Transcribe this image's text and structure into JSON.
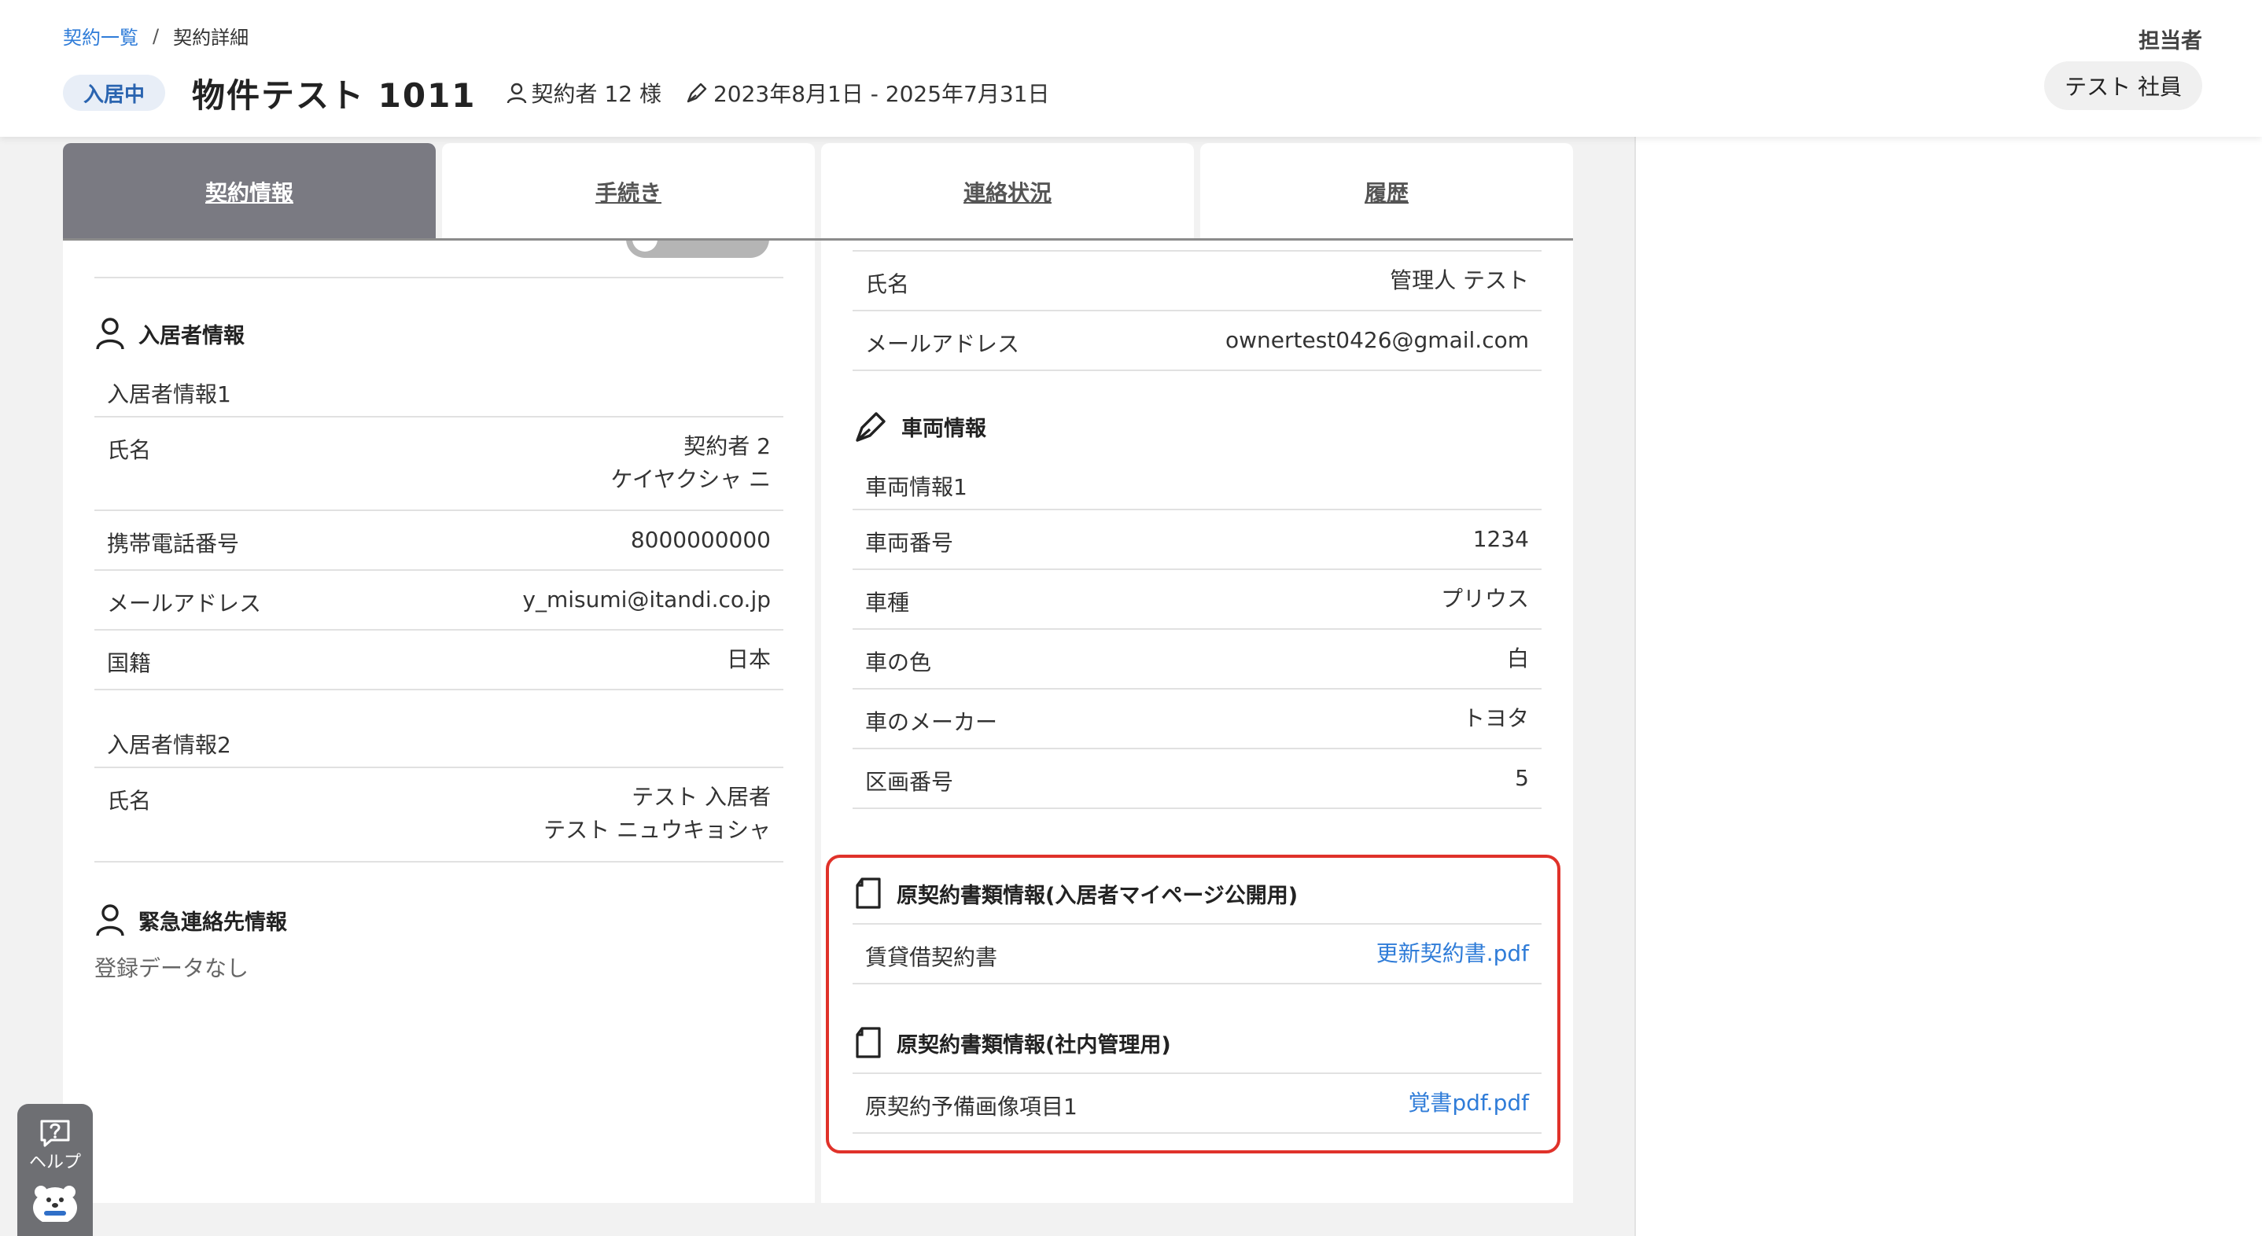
{
  "header": {
    "breadcrumb": {
      "parent": "契約一覧",
      "separator": "/",
      "current": "契約詳細"
    },
    "status_badge": "入居中",
    "title": "物件テスト 1011",
    "contractor": "契約者 12 様",
    "period": "2023年8月1日 - 2025年7月31日",
    "assignee_label": "担当者",
    "assignee_name": "テスト 社員"
  },
  "tabs": [
    {
      "label": "契約情報",
      "active": true
    },
    {
      "label": "手続き",
      "active": false
    },
    {
      "label": "連絡状況",
      "active": false
    },
    {
      "label": "履歴",
      "active": false
    }
  ],
  "residents": {
    "heading": "入居者情報",
    "groups": [
      {
        "title": "入居者情報1",
        "rows": [
          {
            "label": "氏名",
            "value": "契約者 2",
            "value2": "ケイヤクシャ ニ"
          },
          {
            "label": "携帯電話番号",
            "value": "8000000000"
          },
          {
            "label": "メールアドレス",
            "value": "y_misumi@itandi.co.jp"
          },
          {
            "label": "国籍",
            "value": "日本"
          }
        ]
      },
      {
        "title": "入居者情報2",
        "rows": [
          {
            "label": "氏名",
            "value": "テスト 入居者",
            "value2": "テスト ニュウキョシャ"
          }
        ]
      }
    ]
  },
  "emergency": {
    "heading": "緊急連絡先情報",
    "empty": "登録データなし"
  },
  "manager": {
    "rows": [
      {
        "label": "氏名",
        "value": "管理人 テスト"
      },
      {
        "label": "メールアドレス",
        "value": "ownertest0426@gmail.com"
      }
    ]
  },
  "vehicle": {
    "heading": "車両情報",
    "group_title": "車両情報1",
    "rows": [
      {
        "label": "車両番号",
        "value": "1234"
      },
      {
        "label": "車種",
        "value": "プリウス"
      },
      {
        "label": "車の色",
        "value": "白"
      },
      {
        "label": "車のメーカー",
        "value": "トヨタ"
      },
      {
        "label": "区画番号",
        "value": "5"
      }
    ]
  },
  "documents_public": {
    "heading": "原契約書類情報(入居者マイページ公開用)",
    "rows": [
      {
        "label": "賃貸借契約書",
        "value": "更新契約書.pdf"
      }
    ]
  },
  "documents_internal": {
    "heading": "原契約書類情報(社内管理用)",
    "rows": [
      {
        "label": "原契約予備画像項目1",
        "value": "覚書pdf.pdf"
      }
    ]
  },
  "help": {
    "label": "ヘルプ"
  },
  "colors": {
    "link": "#2f7cd8",
    "active_tab": "#7a7a82",
    "highlight": "#e0322a",
    "badge_bg": "#e8eef7"
  }
}
